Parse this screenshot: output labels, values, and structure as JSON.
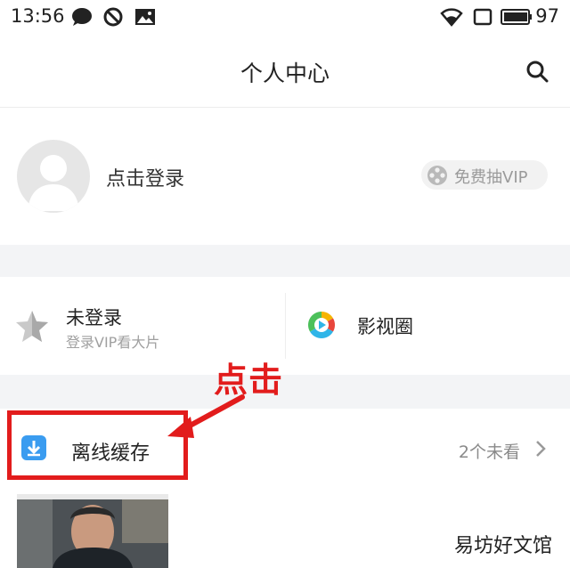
{
  "status_bar": {
    "time": "13:56",
    "battery": "97",
    "icons": [
      "chat-bubble-icon",
      "do-not-disturb-icon",
      "image-icon",
      "wifi-icon",
      "signal-icon",
      "battery-icon"
    ]
  },
  "header": {
    "title": "个人中心",
    "search_icon": "search-icon"
  },
  "profile": {
    "login_label": "点击登录",
    "vip_button": "免费抽VIP"
  },
  "cards": {
    "left": {
      "title": "未登录",
      "subtitle": "登录VIP看大片",
      "icon": "star-icon"
    },
    "right": {
      "title": "影视圈",
      "icon": "play-circle-icon"
    }
  },
  "offline_cache": {
    "label": "离线缓存",
    "count": "2个未看",
    "icon": "download-icon"
  },
  "annotation": {
    "text": "点击",
    "color": "#e21c1c"
  },
  "watermark": "易坊好文馆",
  "colors": {
    "accent_blue": "#3a9cf0",
    "annotation_red": "#e21c1c",
    "section_gap": "#f3f4f6"
  }
}
